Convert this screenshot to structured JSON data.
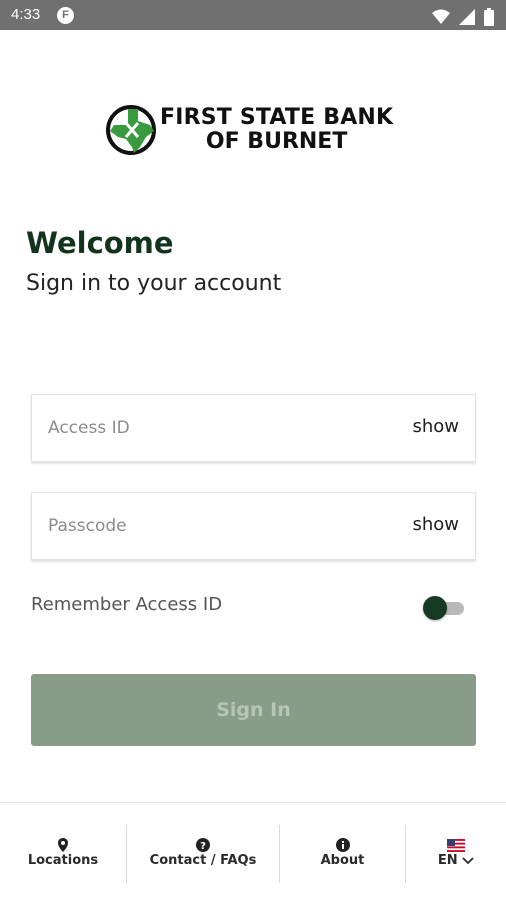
{
  "status_bar": {
    "time": "4:33",
    "app_icon_letter": "F",
    "icons": [
      "wifi-icon",
      "signal-icon",
      "battery-icon"
    ]
  },
  "brand": {
    "line1": "FIRST STATE BANK",
    "line2": "OF BURNET",
    "colors": {
      "green": "#3a9a3f",
      "dark_green": "#12331c"
    }
  },
  "header": {
    "welcome": "Welcome",
    "subtitle": "Sign in to your account"
  },
  "form": {
    "access_id": {
      "placeholder": "Access ID",
      "value": "",
      "toggle_label": "show"
    },
    "passcode": {
      "placeholder": "Passcode",
      "value": "",
      "toggle_label": "show"
    },
    "remember": {
      "label": "Remember Access ID",
      "enabled": false
    },
    "submit_label": "Sign In"
  },
  "bottom_nav": {
    "items": [
      {
        "label": "Locations",
        "icon": "location-pin-icon"
      },
      {
        "label": "Contact / FAQs",
        "icon": "help-icon"
      },
      {
        "label": "About",
        "icon": "info-icon"
      },
      {
        "label": "EN",
        "icon": "us-flag-icon"
      }
    ]
  }
}
